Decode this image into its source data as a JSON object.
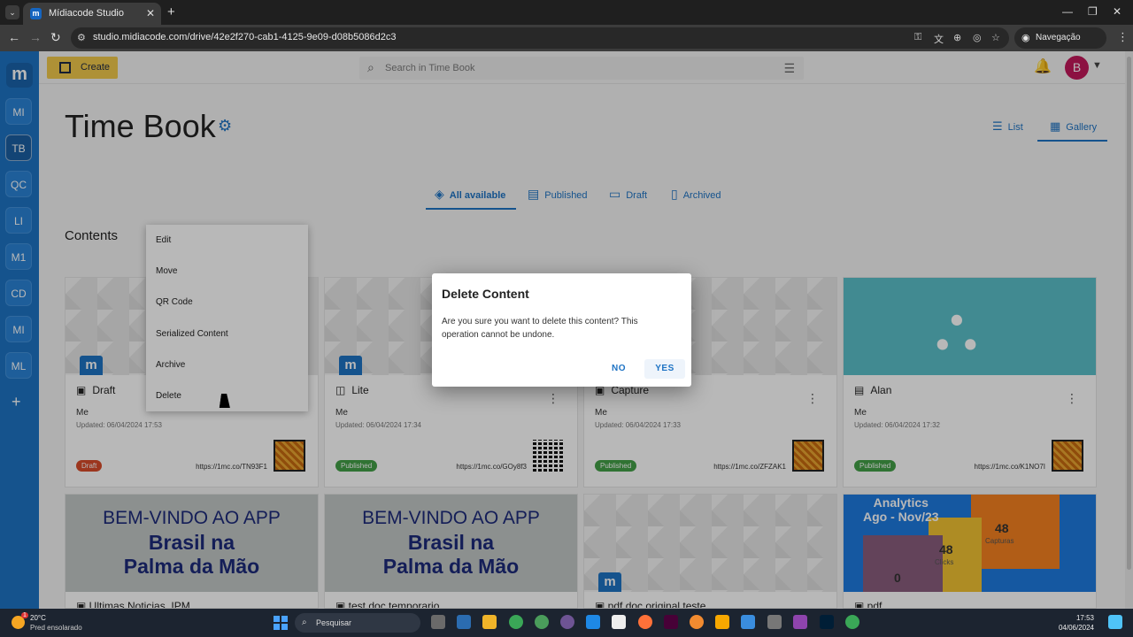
{
  "browser": {
    "tab_title": "Mídiacode Studio",
    "favicon": "m",
    "url": "studio.midiacode.com/drive/42e2f270-cab1-4125-9e09-d08b5086d2c3",
    "incognito_label": "Navegação anônima"
  },
  "sidebar": {
    "logo": "m",
    "items": [
      "MI",
      "TB",
      "QC",
      "LI",
      "M1",
      "CD",
      "MI",
      "ML"
    ],
    "add": "+"
  },
  "topbar": {
    "create_label": "Create",
    "search_placeholder": "Search in Time Book",
    "avatar_initial": "B"
  },
  "page": {
    "title": "Time Book",
    "view_list": "List",
    "view_gallery": "Gallery",
    "filters": [
      "All available",
      "Published",
      "Draft",
      "Archived"
    ],
    "contents_label": "Contents"
  },
  "cards": [
    {
      "title": "Draft",
      "owner": "Me",
      "updated": "Updated: 06/04/2024 17:53",
      "status": "Draft",
      "link": "https://1mc.co/TN93F1"
    },
    {
      "title": "Lite",
      "owner": "Me",
      "updated": "Updated: 06/04/2024 17:34",
      "status": "Published",
      "link": "https://1mc.co/GOy8f3"
    },
    {
      "title": "Capture",
      "owner": "Me",
      "updated": "Updated: 06/04/2024 17:33",
      "status": "Published",
      "link": "https://1mc.co/ZFZAK1"
    },
    {
      "title": "Alan",
      "owner": "Me",
      "updated": "Updated: 06/04/2024 17:32",
      "status": "Published",
      "link": "https://1mc.co/K1NO7I"
    }
  ],
  "cards_row2": [
    {
      "title": "Ultimas Noticias_IPM",
      "banner": [
        "BEM-VINDO AO APP",
        "Brasil na",
        "Palma da Mão"
      ]
    },
    {
      "title": "test doc temporario",
      "banner": [
        "BEM-VINDO AO APP",
        "Brasil na",
        "Palma da Mão"
      ]
    },
    {
      "title": "pdf doc original teste"
    },
    {
      "title": "pdf",
      "analytics": {
        "title1": "Analytics",
        "title2": "Ago - Nov/23",
        "n1": "48",
        "n1_label": "Capturas",
        "n2": "48",
        "n2_label": "Clicks",
        "n3": "0"
      }
    }
  ],
  "context_menu": [
    "Edit",
    "Move",
    "QR Code",
    "Serialized Content",
    "Archive",
    "Delete"
  ],
  "dialog": {
    "title": "Delete Content",
    "message": "Are you sure you want to delete this content? This operation cannot be undone.",
    "no": "NO",
    "yes": "YES"
  },
  "taskbar": {
    "weather_temp": "20°C",
    "weather_desc": "Pred ensolarado",
    "weather_badge": "1",
    "search": "Pesquisar",
    "time": "17:53",
    "date": "04/06/2024"
  }
}
